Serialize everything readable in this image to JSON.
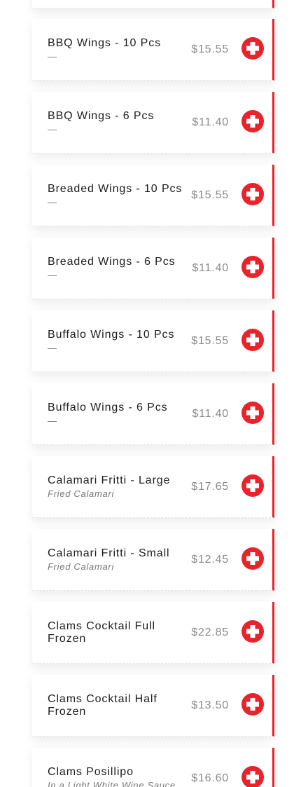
{
  "menu": {
    "items": [
      {
        "name": "",
        "description": "",
        "price": ""
      },
      {
        "name": "BBQ Wings - 10 Pcs",
        "description": "—",
        "price": "$15.55"
      },
      {
        "name": "BBQ Wings - 6 Pcs",
        "description": "—",
        "price": "$11.40"
      },
      {
        "name": "Breaded Wings - 10 Pcs",
        "description": "—",
        "price": "$15.55"
      },
      {
        "name": "Breaded Wings - 6 Pcs",
        "description": "—",
        "price": "$11.40"
      },
      {
        "name": "Buffalo Wings - 10 Pcs",
        "description": "—",
        "price": "$15.55"
      },
      {
        "name": "Buffalo Wings - 6 Pcs",
        "description": "—",
        "price": "$11.40"
      },
      {
        "name": "Calamari Fritti - Large",
        "description": "Fried Calamari",
        "price": "$17.65"
      },
      {
        "name": "Calamari Fritti - Small",
        "description": "Fried Calamari",
        "price": "$12.45"
      },
      {
        "name": "Clams Cocktail Full Frozen",
        "description": "",
        "price": "$22.85"
      },
      {
        "name": "Clams Cocktail Half Frozen",
        "description": "",
        "price": "$13.50"
      },
      {
        "name": "Clams Posillipo",
        "description": "In a Light White Wine Sauce",
        "price": "$16.60"
      }
    ],
    "add_icon": "plus-icon",
    "colors": {
      "accent": "#e8232b",
      "price": "#8a8a8a",
      "name": "#1c1c1c",
      "description": "#777777"
    }
  }
}
